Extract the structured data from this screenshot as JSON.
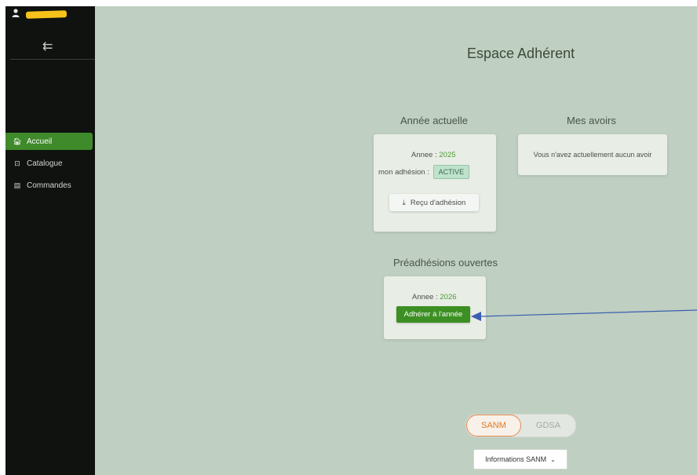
{
  "sidebar": {
    "collapse_icon": "⇇",
    "items": [
      {
        "label": "Accueil",
        "icon": "home-icon",
        "glyph": "🏠︎",
        "active": true
      },
      {
        "label": "Catalogue",
        "icon": "tag-icon",
        "glyph": "⊡",
        "active": false
      },
      {
        "label": "Commandes",
        "icon": "receipt-icon",
        "glyph": "▤",
        "active": false
      }
    ]
  },
  "main": {
    "title": "Espace Adhérent",
    "current_year": {
      "heading": "Année actuelle",
      "year_label": "Annee :",
      "year_value": "2025",
      "membership_label": "mon adhésion :",
      "membership_status": "ACTIVE",
      "receipt_icon": "⤓",
      "receipt_button": "Reçu d'adhésion"
    },
    "credits": {
      "heading": "Mes avoirs",
      "empty_text": "Vous n'avez actuellement aucun avoir"
    },
    "pre_membership": {
      "heading": "Préadhésions ouvertes",
      "year_label": "Annee :",
      "year_value": "2026",
      "join_button": "Adhérer à l'année"
    },
    "org_toggle": {
      "options": [
        "SANM",
        "GDSA"
      ],
      "selected": "SANM"
    },
    "info_dropdown": {
      "label": "Informations SANM",
      "chevron": "⌄"
    }
  },
  "colors": {
    "accent_green": "#3c8f22",
    "sidebar_bg": "#0f120f",
    "main_bg": "#bfcfc1",
    "toggle_active": "#e07a24",
    "annotation_arrow": "#3a5fb0"
  }
}
